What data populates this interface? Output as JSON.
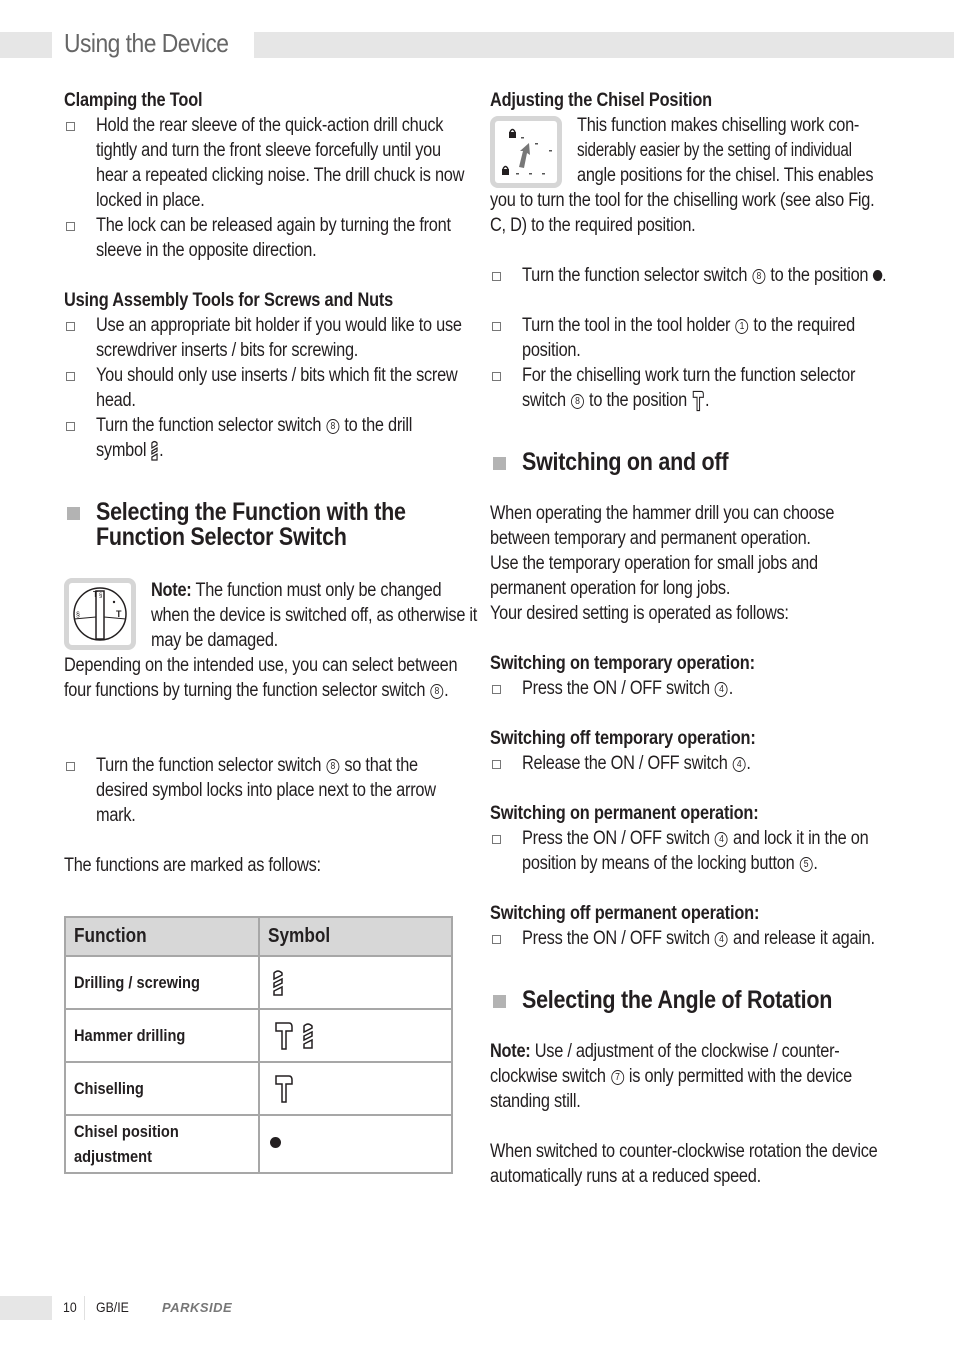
{
  "header": {
    "title": "Using the Device"
  },
  "left_column": {
    "clamping": {
      "heading": "Clamping the Tool",
      "items": [
        "Hold the rear sleeve of the quick-action drill chuck tightly and turn the front sleeve forcefully until you hear a repeated clicking noise. The drill chuck is now locked in place.",
        "The lock can be released again by turning the front sleeve in the opposite direction."
      ]
    },
    "assembly": {
      "heading": "Using Assembly Tools for Screws and Nuts",
      "items": [
        "Use an appropriate bit holder if you would like to use screwdriver inserts / bits for screwing.",
        "You should only use inserts / bits which fit the screw head."
      ],
      "item3_a": "Turn the function selector switch",
      "item3_ref": "8",
      "item3_b": "to the drill symbol",
      "item3_icon": "drill-bit-icon"
    },
    "selecting_function": {
      "heading_line1": "Selecting the Function with the",
      "heading_line2": "Function Selector Switch",
      "note_label": "Note:",
      "note_text": "The function must only be changed when the device is switched off, as otherwise it may be damaged.",
      "para_a": "Depending on the intended use, you can select between four functions by turning the function selector switch",
      "para_ref": "8",
      "bullet_a": "Turn the function selector switch",
      "bullet_ref": "8",
      "bullet_b": "so that the desired symbol locks into place next to the arrow mark.",
      "marked_text": "The functions are marked as follows:"
    },
    "table": {
      "headers": [
        "Function",
        "Symbol"
      ],
      "rows": [
        {
          "function": "Drilling / screwing",
          "symbols": [
            "drill-bit-icon"
          ]
        },
        {
          "function": "Hammer drilling",
          "symbols": [
            "hammer-icon",
            "drill-bit-icon"
          ]
        },
        {
          "function": "Chiselling",
          "symbols": [
            "hammer-icon"
          ]
        },
        {
          "function_line1": "Chisel position",
          "function_line2": "adjustment",
          "symbols": [
            "dot-icon"
          ]
        }
      ]
    }
  },
  "right_column": {
    "chisel": {
      "heading": "Adjusting the Chisel Position",
      "intro_line1": "This function makes chiselling work con-",
      "intro_line2": "siderably easier by the setting of individual",
      "intro_line3": "angle positions for the chisel. This enables",
      "intro_rest": "you to turn the tool for the chiselling work (see also Fig. C, D) to the required position.",
      "b1_a": "Turn the function selector switch",
      "b1_ref": "8",
      "b1_b": "to the position",
      "b2_a": "Turn the tool in the tool holder",
      "b2_ref": "1",
      "b2_b": "to the required position.",
      "b3_a": "For the chiselling work turn the function selector switch",
      "b3_ref": "8",
      "b3_b": "to the position"
    },
    "switching": {
      "heading": "Switching on and off",
      "intro": [
        "When operating the hammer drill you can choose between temporary and permanent operation.",
        "Use the temporary operation for small jobs and permanent operation for long jobs.",
        "Your desired setting is operated as follows:"
      ],
      "on_temp_heading": "Switching on temporary operation:",
      "on_temp_a": "Press the ON / OFF switch",
      "on_temp_ref": "4",
      "off_temp_heading": "Switching off temporary operation:",
      "off_temp_a": "Release the ON / OFF switch",
      "off_temp_ref": "4",
      "on_perm_heading": "Switching on permanent operation:",
      "on_perm_a": "Press the ON / OFF switch",
      "on_perm_ref": "4",
      "on_perm_b": "and lock it in the on position by means of the locking button",
      "on_perm_ref2": "5",
      "off_perm_heading": "Switching off permanent operation:",
      "off_perm_a": "Press the ON / OFF switch",
      "off_perm_ref": "4",
      "off_perm_b": "and release it again."
    },
    "rotation": {
      "heading": "Selecting the Angle of Rotation",
      "note_label": "Note:",
      "note_a": "Use / adjustment of the clockwise / counter-clockwise switch",
      "note_ref": "7",
      "note_b": "is only permitted with the device standing still.",
      "para": "When switched to counter-clockwise rotation the device automatically runs at a reduced speed."
    }
  },
  "footer": {
    "page_number": "10",
    "locale": "GB/IE",
    "brand": "PARKSIDE"
  }
}
